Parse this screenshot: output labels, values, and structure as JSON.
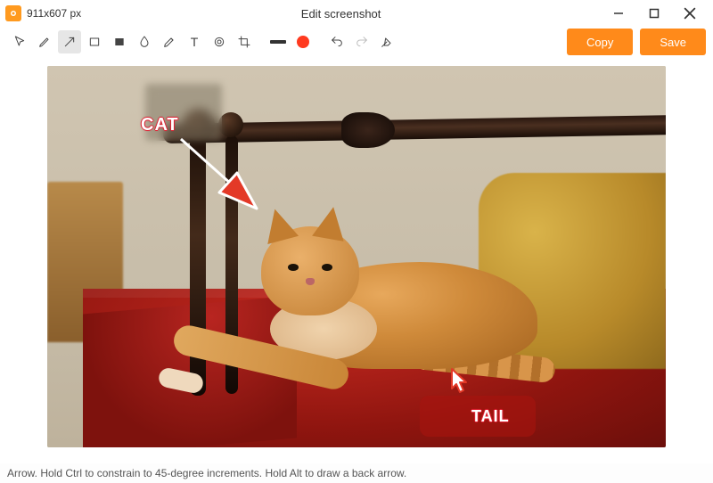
{
  "window": {
    "dimensions": "911x607 px",
    "title": "Edit screenshot"
  },
  "toolbar": {
    "tools": {
      "cursor": "cursor",
      "pen": "pen",
      "arrow": "arrow",
      "rect": "rectangle",
      "rect_filled": "filled-rectangle",
      "blur": "blur",
      "marker": "marker",
      "text": "text",
      "counter": "counter",
      "crop": "crop",
      "thickness": "line-thickness",
      "color": "color",
      "undo": "undo",
      "redo": "redo",
      "clear": "clear"
    },
    "active_tool": "arrow",
    "color_hex": "#ff3a1f",
    "copy_label": "Copy",
    "save_label": "Save"
  },
  "annotations": {
    "cat_label": "CAT",
    "tail_label": "TAIL"
  },
  "statusbar": {
    "hint": "Arrow. Hold Ctrl to constrain to 45-degree increments. Hold Alt to draw a back arrow."
  }
}
